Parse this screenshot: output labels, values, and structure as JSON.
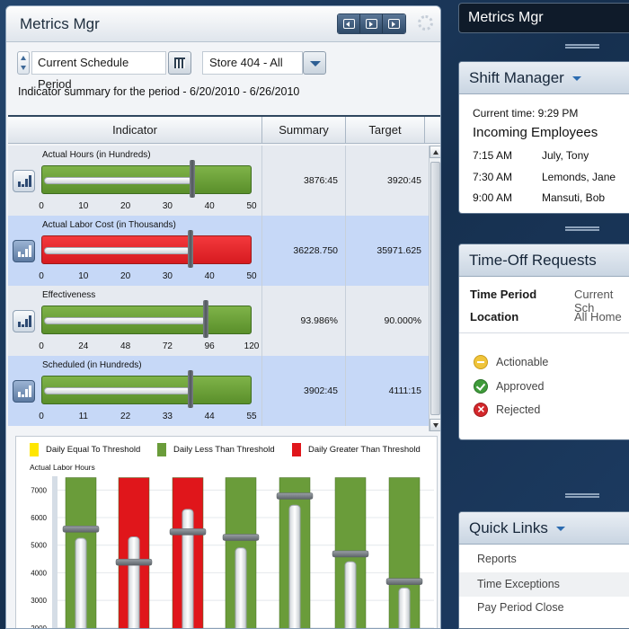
{
  "metrics": {
    "title": "Metrics Mgr",
    "period": "Current Schedule Period",
    "store": "Store 404 - All",
    "summary_line": "Indicator summary for the period - 6/20/2010 - 6/26/2010",
    "columns": [
      "Indicator",
      "Summary",
      "Target"
    ],
    "rows": [
      {
        "label": "Actual Hours   (in Hundreds)",
        "summary": "3876:45",
        "target": "3920:45",
        "fill_pct": 72,
        "ticks": [
          "0",
          "10",
          "20",
          "30",
          "40",
          "50"
        ],
        "bar_color": "green",
        "highlight": false
      },
      {
        "label": "Actual Labor Cost   (in Thousands)",
        "summary": "36228.750",
        "target": "35971.625",
        "fill_pct": 71,
        "ticks": [
          "0",
          "10",
          "20",
          "30",
          "40",
          "50"
        ],
        "bar_color": "red",
        "highlight": true
      },
      {
        "label": "Effectiveness",
        "summary": "93.986%",
        "target": "90.000%",
        "fill_pct": 78,
        "ticks": [
          "0",
          "24",
          "48",
          "72",
          "96",
          "120"
        ],
        "bar_color": "green",
        "highlight": false
      },
      {
        "label": "Scheduled   (in Hundreds)",
        "summary": "3902:45",
        "target": "4111:15",
        "fill_pct": 71,
        "ticks": [
          "0",
          "11",
          "22",
          "33",
          "44",
          "55"
        ],
        "bar_color": "green",
        "highlight": true
      }
    ]
  },
  "chart_data": {
    "type": "bar",
    "legend": [
      "Daily Equal To Threshold",
      "Daily Less Than Threshold",
      "Daily Greater Than Threshold"
    ],
    "legend_colors": [
      "#ffe600",
      "#6a9c3a",
      "#e0161b"
    ],
    "ylabel": "Actual Labor Hours",
    "yticks": [
      "7000",
      "6000",
      "5000",
      "4000",
      "3000",
      "2000"
    ],
    "ylim": [
      1700,
      7500
    ],
    "series": [
      {
        "threshold": 5600,
        "actual": 5250,
        "status": "less"
      },
      {
        "threshold": 4400,
        "actual": 5300,
        "status": "greater"
      },
      {
        "threshold": 5500,
        "actual": 6300,
        "status": "greater"
      },
      {
        "threshold": 5300,
        "actual": 4900,
        "status": "less"
      },
      {
        "threshold": 6800,
        "actual": 6450,
        "status": "less"
      },
      {
        "threshold": 4700,
        "actual": 4400,
        "status": "less"
      },
      {
        "threshold": 3700,
        "actual": 3450,
        "status": "less"
      }
    ],
    "colors": {
      "less": "#6a9c3a",
      "greater": "#e0161b",
      "equal": "#ffe600"
    }
  },
  "right": {
    "title": "Metrics Mgr",
    "shift": {
      "title": "Shift Manager",
      "current_time": "Current time: 9:29 PM",
      "incoming": "Incoming Employees",
      "employees": [
        {
          "time": "7:15 AM",
          "name": "July, Tony"
        },
        {
          "time": "7:30 AM",
          "name": "Lemonds, Jane"
        },
        {
          "time": "9:00 AM",
          "name": "Mansuti, Bob"
        }
      ]
    },
    "timeoff": {
      "title": "Time-Off Requests",
      "time_period_label": "Time Period",
      "time_period_value": "Current Sch",
      "location_label": "Location",
      "location_value": "All Home",
      "statuses": [
        "Actionable",
        "Approved",
        "Rejected"
      ]
    },
    "quicklinks": {
      "title": "Quick Links",
      "items": [
        "Reports",
        "Time Exceptions",
        "Pay Period Close"
      ]
    }
  }
}
